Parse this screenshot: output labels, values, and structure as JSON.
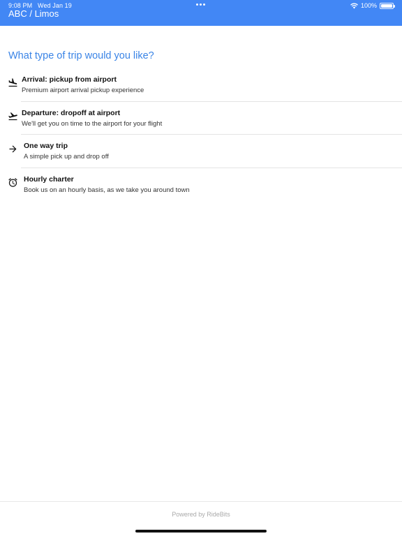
{
  "status_bar": {
    "time": "9:08 PM",
    "date": "Wed Jan 19",
    "battery": "100%",
    "wifi_icon": "wifi-icon",
    "battery_icon": "battery-icon"
  },
  "header": {
    "title": "ABC / Limos",
    "background_color": "#4287f5"
  },
  "main": {
    "question": "What type of trip would you like?",
    "question_color": "#3a84e6",
    "trip_options": [
      {
        "title": "Arrival: pickup from airport",
        "subtitle": "Premium airport arrival pickup experience",
        "icon": "flight-land-icon"
      },
      {
        "title": "Departure: dropoff at airport",
        "subtitle": "We'll get you on time to the airport for your flight",
        "icon": "flight-takeoff-icon"
      },
      {
        "title": "One way trip",
        "subtitle": "A simple pick up and drop off",
        "icon": "arrow-right-icon"
      },
      {
        "title": "Hourly charter",
        "subtitle": "Book us on an hourly basis, as we take you around town",
        "icon": "alarm-clock-icon"
      }
    ]
  },
  "footer": {
    "text": "Powered by RideBits"
  }
}
